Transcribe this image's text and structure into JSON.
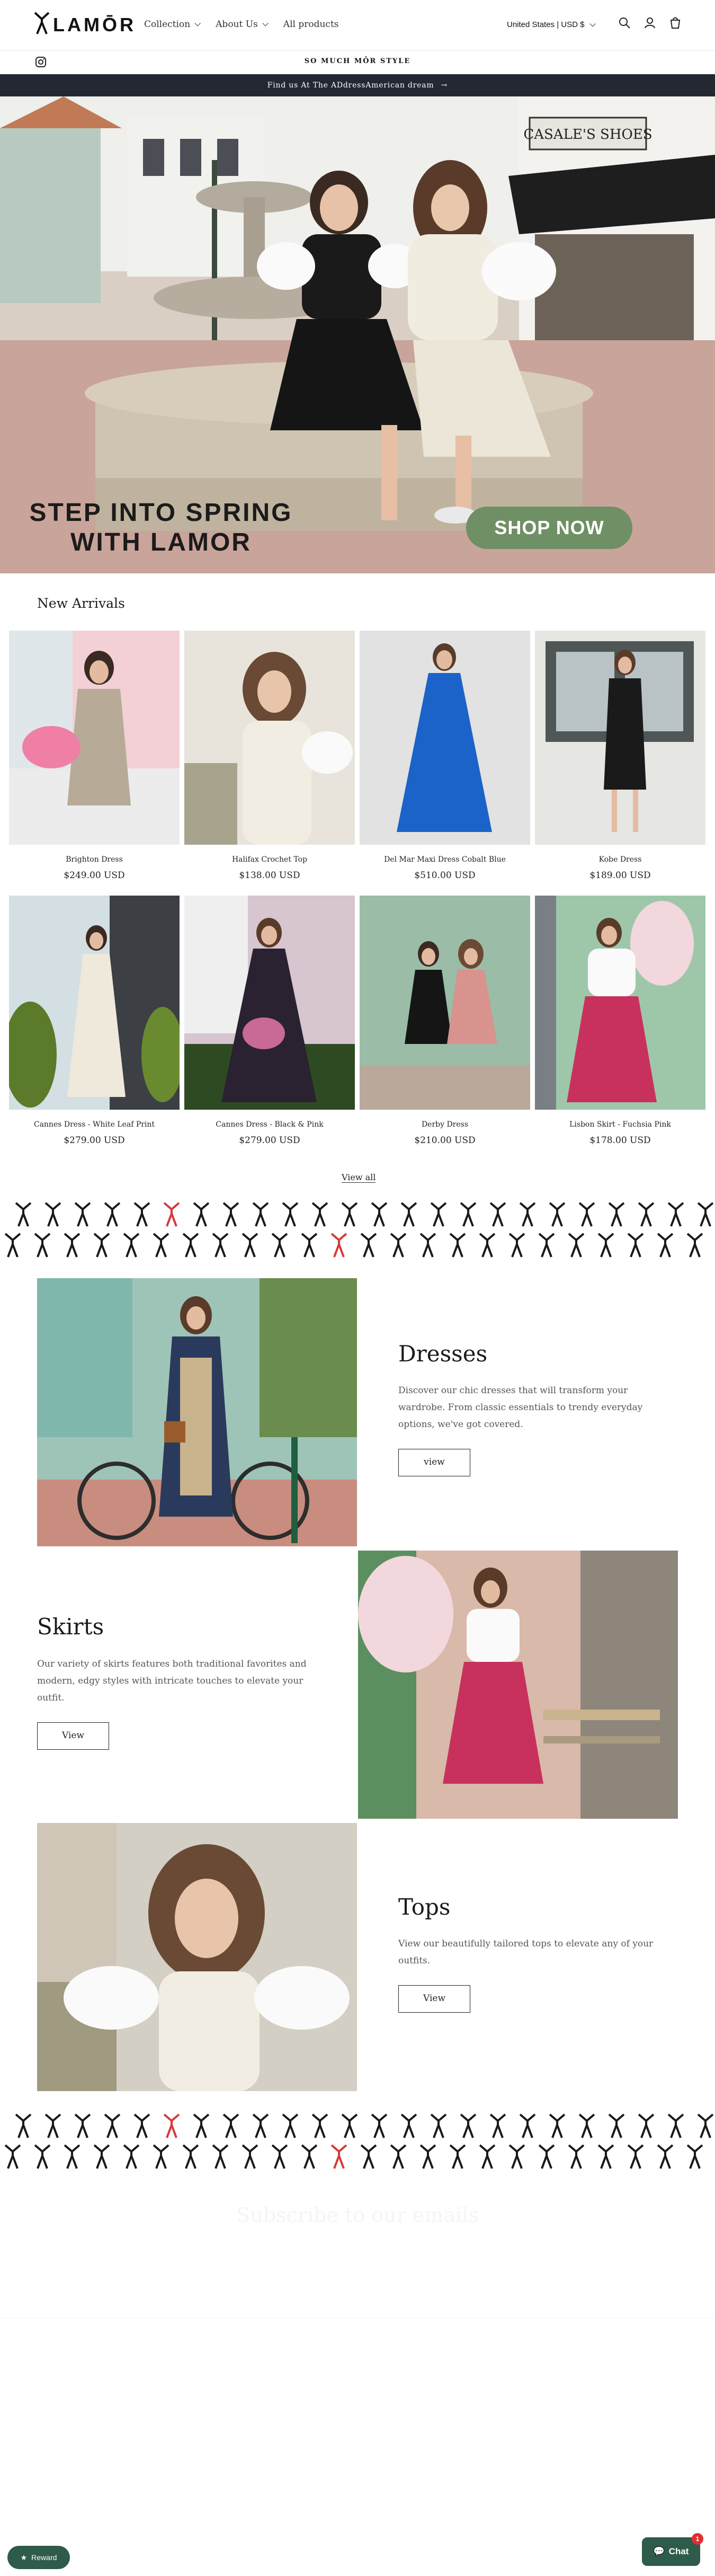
{
  "header": {
    "logo_text": "LAMŌR",
    "nav": [
      {
        "label": "Collection",
        "has_dropdown": true
      },
      {
        "label": "About Us",
        "has_dropdown": true
      },
      {
        "label": "All products",
        "has_dropdown": false
      }
    ],
    "currency": "United States | USD $",
    "icons": [
      "search-icon",
      "account-icon",
      "cart-icon"
    ]
  },
  "social": {
    "ticker": "SO MUCH MŌR STYLE",
    "icon": "instagram-icon"
  },
  "announcement": {
    "text": "Find us At The ADdressAmerican dream",
    "icon": "arrow-right-icon"
  },
  "hero": {
    "title_line1": "STEP INTO SPRING",
    "title_line2": "WITH LAMOR",
    "button": "SHOP NOW"
  },
  "new_arrivals": {
    "heading": "New Arrivals",
    "products": [
      {
        "name": "Brighton Dress",
        "price": "$249.00 USD"
      },
      {
        "name": "Halifax Crochet Top",
        "price": "$138.00 USD"
      },
      {
        "name": "Del Mar Maxi Dress Cobalt Blue",
        "price": "$510.00 USD"
      },
      {
        "name": "Kobe Dress",
        "price": "$189.00 USD"
      },
      {
        "name": "Cannes Dress - White Leaf Print",
        "price": "$279.00 USD"
      },
      {
        "name": "Cannes Dress - Black & Pink",
        "price": "$279.00 USD"
      },
      {
        "name": "Derby Dress",
        "price": "$210.00 USD"
      },
      {
        "name": "Lisbon Skirt - Fuchsia Pink",
        "price": "$178.00 USD"
      }
    ],
    "view_all": "View all"
  },
  "features": [
    {
      "title": "Dresses",
      "text": "Discover our chic dresses that will transform your wardrobe. From classic essentials to trendy everyday options, we've got covered.",
      "button": "view"
    },
    {
      "title": "Skirts",
      "text": "Our variety of skirts features both traditional favorites and modern, edgy styles with intricate touches to elevate your outfit.",
      "button": "View"
    },
    {
      "title": "Tops",
      "text": "View our beautifully tailored tops to elevate any of your outfits.",
      "button": "View"
    }
  ],
  "subscribe": {
    "heading": "Subscribe to our emails"
  },
  "widgets": {
    "rewards": "Reward",
    "chat": "Chat",
    "chat_badge": "1"
  },
  "colors": {
    "announcement_bg": "#242833",
    "accent_green": "#6f8f64",
    "widget_green": "#2f5b4a",
    "eiffel_red": "#d63a3a"
  }
}
